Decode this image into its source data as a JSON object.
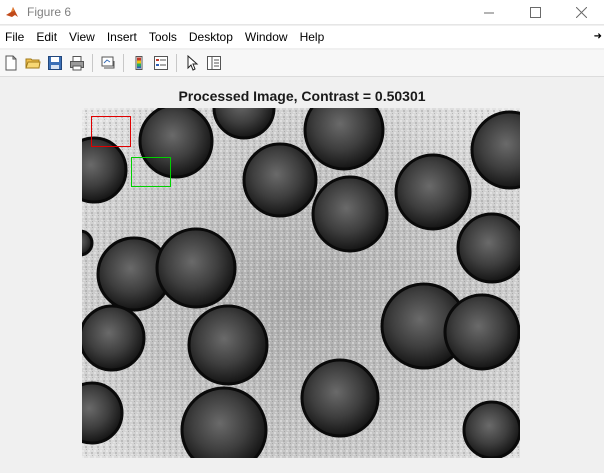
{
  "window": {
    "title": "Figure 6",
    "minimize_icon": "minimize-icon",
    "maximize_icon": "maximize-icon",
    "close_icon": "close-icon"
  },
  "menu": {
    "items": [
      "File",
      "Edit",
      "View",
      "Insert",
      "Tools",
      "Desktop",
      "Window",
      "Help"
    ],
    "overflow_icon": "chevron-right-icon"
  },
  "toolbar": {
    "buttons": [
      {
        "icon": "new-figure-icon"
      },
      {
        "icon": "open-folder-icon"
      },
      {
        "icon": "save-icon"
      },
      {
        "icon": "print-icon"
      },
      {
        "icon": "link-plot-icon"
      },
      {
        "icon": "insert-colorbar-icon"
      },
      {
        "icon": "insert-legend-icon"
      },
      {
        "icon": "edit-plot-arrow-icon"
      },
      {
        "icon": "property-inspector-icon"
      }
    ]
  },
  "figure": {
    "title": "Processed Image, Contrast = 0.50301",
    "roi_colors": {
      "first": "#e00000",
      "second": "#00d000"
    }
  }
}
